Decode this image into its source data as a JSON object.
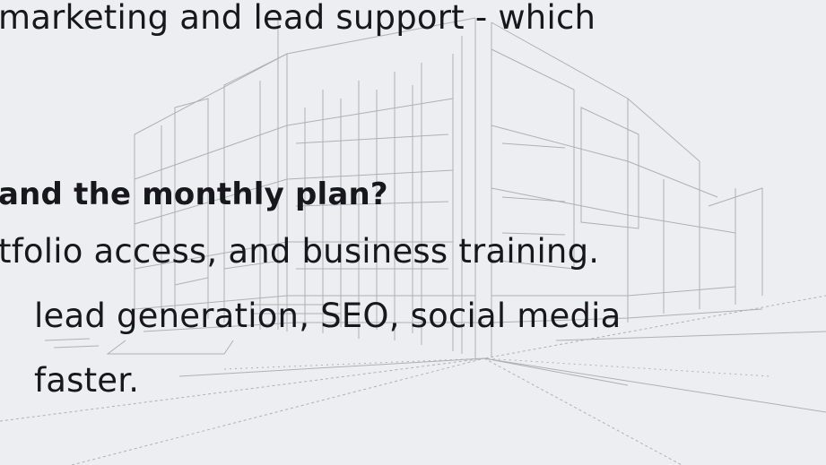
{
  "faq": {
    "prev_answer_tail": "marketing and lead support - which",
    "question_tail": "and the monthly plan?",
    "answer_lines": [
      "tfolio access, and business training.",
      "lead generation, SEO, social media",
      "faster."
    ]
  },
  "colors": {
    "background": "#edeef2",
    "text": "#17171d",
    "illustration_lines": "#9a9ca3"
  }
}
